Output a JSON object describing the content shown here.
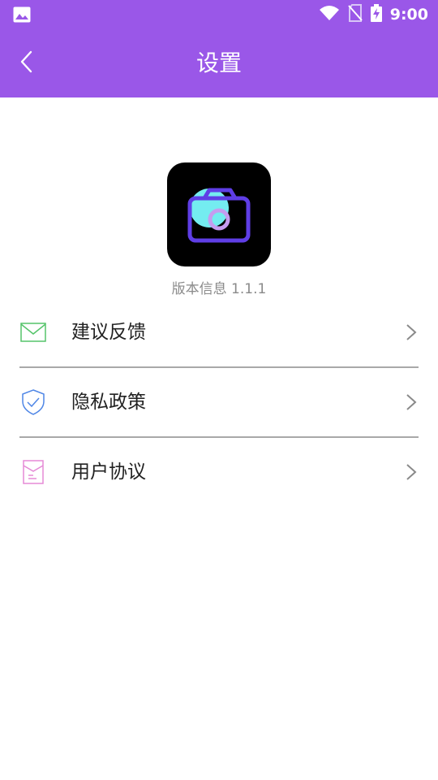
{
  "status_bar": {
    "time": "9:00",
    "icons": [
      "image-icon",
      "wifi-icon",
      "no-sim-icon",
      "battery-charging-icon"
    ]
  },
  "header": {
    "title": "设置",
    "back_icon": "back-chevron-icon"
  },
  "app_info": {
    "logo_icon": "camera-app-logo",
    "version_text": "版本信息 1.1.1"
  },
  "menu": {
    "items": [
      {
        "label": "建议反馈",
        "icon": "mail-icon"
      },
      {
        "label": "隐私政策",
        "icon": "shield-check-icon"
      },
      {
        "label": "用户协议",
        "icon": "document-icon"
      }
    ]
  },
  "colors": {
    "header_background": "#9a57e8",
    "title_text": "#ffffff",
    "version_text": "#8a8a8a",
    "menu_text": "#222222",
    "divider": "#a9a9a9",
    "mail_icon": "#55c46a",
    "shield_icon": "#4f86e6",
    "document_icon": "#e58ad6"
  }
}
